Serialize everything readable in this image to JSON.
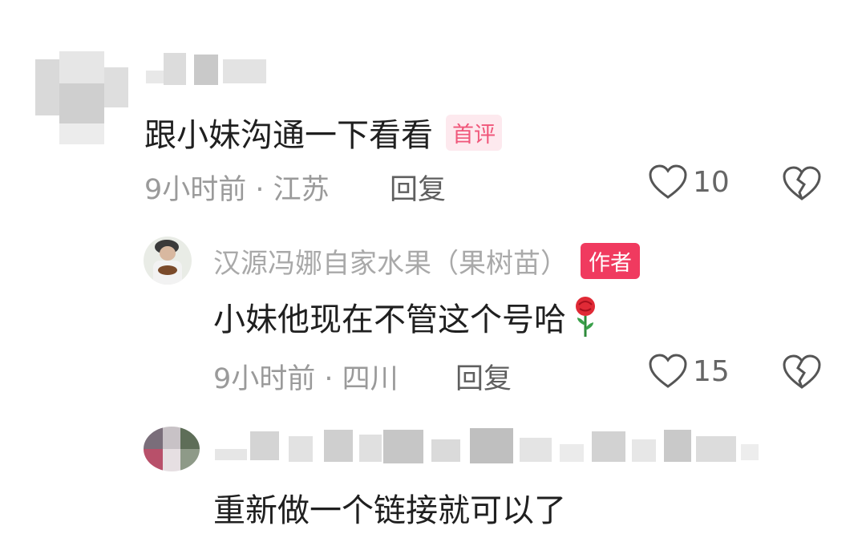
{
  "comments": [
    {
      "text": "跟小妹沟通一下看看",
      "badge": "首评",
      "time": "9小时前 · 江苏",
      "reply": "回复",
      "likes": "10"
    },
    {
      "name": "汉源冯娜自家水果（果树苗）",
      "badge": "作者",
      "text": "小妹他现在不管这个号哈",
      "time": "9小时前 · 四川",
      "reply": "回复",
      "likes": "15"
    },
    {
      "text": "重新做一个链接就可以了"
    }
  ],
  "colors": {
    "author_badge": "#f03a5f",
    "first_badge_text": "#f0577a",
    "meta": "#9a9a9a"
  },
  "icons": [
    "heart-icon",
    "broken-heart-icon",
    "rose-icon"
  ]
}
